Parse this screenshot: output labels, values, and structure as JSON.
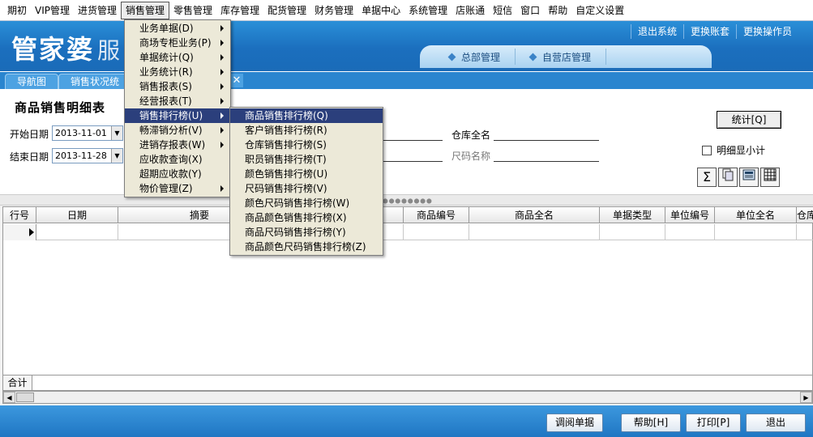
{
  "menubar": {
    "items": [
      "期初",
      "VIP管理",
      "进货管理",
      "销售管理",
      "零售管理",
      "库存管理",
      "配货管理",
      "财务管理",
      "单据中心",
      "系统管理",
      "店账通",
      "短信",
      "窗口",
      "帮助",
      "自定义设置"
    ],
    "active_index": 3
  },
  "banner": {
    "logo_main": "管家婆",
    "logo_sub": "服",
    "top_buttons": [
      "退出系统",
      "更换账套",
      "更换操作员"
    ],
    "nav_tabs": [
      "总部管理",
      "自营店管理"
    ]
  },
  "doc_tabs": {
    "items": [
      "导航图",
      "销售状况统"
    ],
    "close_glyph": "✕"
  },
  "form": {
    "title": "商品销售明细表",
    "start_label": "开始日期",
    "start_value": "2013-11-01",
    "end_label": "结束日期",
    "end_value": "2013-11-28",
    "warehouse_label": "仓库全名",
    "size_label": "尺码名称",
    "stat_button": "统计[Q]",
    "detail_subtotal": "明细显小计",
    "detail_checked": false,
    "icons": [
      "sum-icon",
      "copy-icon",
      "calculator-icon",
      "grid-icon"
    ]
  },
  "grid": {
    "columns": [
      "行号",
      "日期",
      "摘要",
      "",
      "商品编号",
      "商品全名",
      "单据类型",
      "单位编号",
      "单位全名",
      "仓库"
    ],
    "footer_label": "合计"
  },
  "bottom_buttons": [
    "调阅单据",
    "帮助[H]",
    "打印[P]",
    "退出"
  ],
  "menu_sales": {
    "items": [
      {
        "label": "业务单据(D)",
        "sub": true
      },
      {
        "label": "商场专柜业务(P)",
        "sub": true
      },
      {
        "label": "单据统计(Q)",
        "sub": true
      },
      {
        "label": "业务统计(R)",
        "sub": true
      },
      {
        "label": "销售报表(S)",
        "sub": true
      },
      {
        "label": "经营报表(T)",
        "sub": true
      },
      {
        "label": "销售排行榜(U)",
        "sub": true
      },
      {
        "label": "畅滞销分析(V)",
        "sub": true
      },
      {
        "label": "进销存报表(W)",
        "sub": true
      },
      {
        "label": "应收款查询(X)",
        "sub": false
      },
      {
        "label": "超期应收款(Y)",
        "sub": false
      },
      {
        "label": "物价管理(Z)",
        "sub": true
      }
    ],
    "highlighted_index": 6
  },
  "menu_ranking": {
    "items": [
      "商品销售排行榜(Q)",
      "客户销售排行榜(R)",
      "仓库销售排行榜(S)",
      "职员销售排行榜(T)",
      "颜色销售排行榜(U)",
      "尺码销售排行榜(V)",
      "颜色尺码销售排行榜(W)",
      "商品颜色销售排行榜(X)",
      "商品尺码销售排行榜(Y)",
      "商品颜色尺码销售排行榜(Z)"
    ],
    "highlighted_index": 0
  }
}
